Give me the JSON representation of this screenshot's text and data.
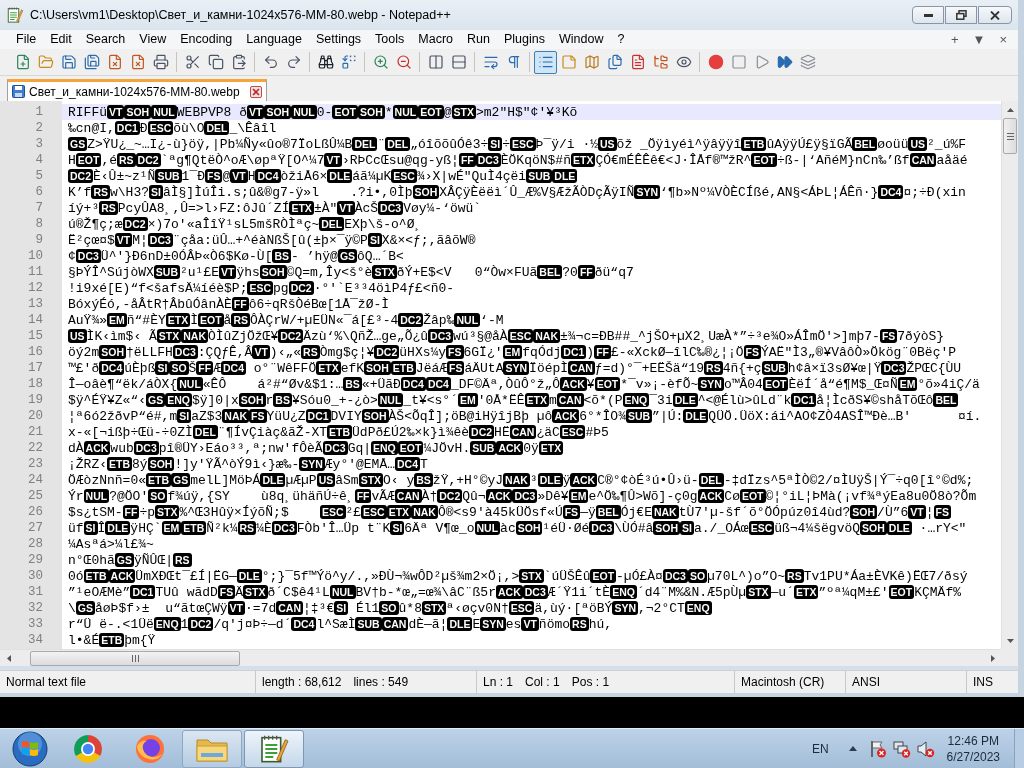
{
  "window": {
    "title": "C:\\Users\\vm1\\Desktop\\Свет_и_камни-1024x576-MM-80.webp - Notepad++"
  },
  "menu": {
    "items": [
      "File",
      "Edit",
      "Search",
      "View",
      "Encoding",
      "Language",
      "Settings",
      "Tools",
      "Macro",
      "Run",
      "Plugins",
      "Window",
      "?"
    ],
    "document_controls": [
      "+",
      "▼",
      "×"
    ]
  },
  "toolbar": [
    {
      "pressed": false
    },
    {
      "pressed": false
    },
    {
      "pressed": false
    },
    {
      "pressed": false
    },
    {
      "pressed": false
    },
    {
      "pressed": false
    },
    {
      "pressed": false
    },
    {
      "pressed": false
    },
    {
      "pressed": false
    },
    {
      "pressed": false
    },
    {
      "pressed": false
    },
    {
      "pressed": false
    },
    {
      "pressed": false
    },
    {
      "pressed": false
    },
    {
      "pressed": false
    },
    {
      "pressed": false
    },
    {
      "pressed": false
    },
    {
      "pressed": false
    },
    {
      "pressed": false
    },
    {
      "pressed": false
    },
    {
      "pressed": true
    },
    {
      "pressed": false
    },
    {
      "pressed": false
    },
    {
      "pressed": false
    },
    {
      "pressed": false
    },
    {
      "pressed": false
    },
    {
      "pressed": false
    },
    {
      "pressed": false
    },
    {
      "pressed": false
    },
    {
      "pressed": false
    },
    {
      "pressed": false
    },
    {
      "pressed": false
    }
  ],
  "tabs": [
    {
      "label": "Свет_и_камни-1024x576-MM-80.webp",
      "selected": true
    }
  ],
  "editor": {
    "lines": [
      {
        "number": "1",
        "current": true,
        "segments": [
          {
            "text": "RIFFü",
            "control": "VT"
          },
          {
            "control": "SOH"
          },
          {
            "control": "NUL"
          },
          {
            "text": "WEBPVP8 ð",
            "control": "VT"
          },
          {
            "control": "SOH"
          },
          {
            "control": "NUL"
          },
          {
            "text": "0-",
            "control": "EOT"
          },
          {
            "control": "SOH"
          },
          {
            "text": "*",
            "control": "NUL"
          },
          {
            "control": "EOT"
          },
          {
            "text": "@",
            "control": "STX"
          },
          {
            "text": ">m2″H$\"¢'¥³Kõ"
          }
        ]
      },
      {
        "number": "2",
        "current": false,
        "segments": [
          {
            "text": "‰cn@I,",
            "control": "DC1"
          },
          {
            "text": "Ð",
            "control": "ESC"
          },
          {
            "text": "õù\\O",
            "control": "DEL"
          },
          {
            "text": "_\\Êâîl"
          }
        ]
      },
      {
        "number": "3",
        "current": false,
        "segments": [
          {
            "control": "GS"
          },
          {
            "text": "Z>ŸU¿_~…I¿-ù}öÿ,|Pb¼Ñy«ûo®7ÏoLßÛ¼B",
            "control": "DEL"
          },
          {
            "text": "¨",
            "control": "DEL"
          },
          {
            "text": "„óîõõûÓê3÷",
            "control": "SI"
          },
          {
            "text": "÷",
            "control": "ESC"
          },
          {
            "text": "Þ¯ÿ/i ·½",
            "control": "US"
          },
          {
            "text": "õž _Öÿìyéì^ÿâÿÿî",
            "control": "ETB"
          },
          {
            "text": "ûAÿÿÚ£ÿ§ïGÃ",
            "control": "BEL"
          },
          {
            "text": "øoüü",
            "control": "US"
          },
          {
            "text": "²_ú%F"
          }
        ]
      },
      {
        "number": "4",
        "current": false,
        "segments": [
          {
            "text": "H",
            "control": "EOT"
          },
          {
            "text": ",é",
            "control": "RS"
          },
          {
            "control": "DC2"
          },
          {
            "text": "`ªg¶QtëÒ^oÆ\\øpªŸ[O^¼7",
            "control": "VT"
          },
          {
            "text": "›RÞCcŒsu@qg-yß¦",
            "control": "FF"
          },
          {
            "control": "DC3"
          },
          {
            "text": "ÈÖKqöN$#ñ",
            "control": "ETX"
          },
          {
            "text": "ÇÓ€mÉÊÊê€<J·ÎÅf®™žR^",
            "control": "EOT"
          },
          {
            "text": "÷ß-|‘AñéM}nCn‰’ßf",
            "control": "CAN"
          },
          {
            "text": "aåäé"
          }
        ]
      },
      {
        "number": "5",
        "current": false,
        "segments": [
          {
            "control": "DC2"
          },
          {
            "text": "È‹Û±~z¹Ñ",
            "control": "SUB"
          },
          {
            "text": "1¯Ð",
            "control": "FS"
          },
          {
            "text": "@",
            "control": "VT"
          },
          {
            "text": "H",
            "control": "DC4"
          },
          {
            "text": "òžiÅ6×",
            "control": "DLE"
          },
          {
            "text": "áã¼µK",
            "control": "ESC"
          },
          {
            "text": "¾›X|wÉ\"QuÌ4çëi",
            "control": "SUB"
          },
          {
            "control": "DLE"
          }
        ]
      },
      {
        "number": "6",
        "current": false,
        "segments": [
          {
            "text": "K’f",
            "control": "RS"
          },
          {
            "text": "w\\H3?",
            "control": "SI"
          },
          {
            "text": "âÌ§]ÌúÎi.s;û&®g7-ÿ»l    .?i•,0Ìþ",
            "control": "SOH"
          },
          {
            "text": "XÂÇÿÈëëì´Û_Æ%V§ÆžÃÒDçÃÿIÑ",
            "control": "SYN"
          },
          {
            "text": "‘¶b»Nº¼VÒÈCÍßé,AN§<ÁÞL¦ÁÊñ·}",
            "control": "DC4"
          },
          {
            "text": "¤;÷Ð(xin"
          }
        ]
      },
      {
        "number": "7",
        "current": false,
        "segments": [
          {
            "text": "íý+³",
            "control": "RS"
          },
          {
            "text": "PcyÛA8¸,Û=>l›FZ:ôJû´ZÍ",
            "control": "ETX"
          },
          {
            "text": "±À\"",
            "control": "VT"
          },
          {
            "text": "ÀcŠ",
            "control": "DC3"
          },
          {
            "text": "Vøy¼-‘öwü`"
          }
        ]
      },
      {
        "number": "8",
        "current": false,
        "segments": [
          {
            "text": "ú®Ž¶ç;æ",
            "control": "DC2"
          },
          {
            "text": "×)7o'«aÎîŸ¹sL5mšRÒÌªç~",
            "control": "DEL"
          },
          {
            "text": "EXþ\\š-o^Ø¸"
          }
        ]
      },
      {
        "number": "9",
        "current": false,
        "segments": [
          {
            "text": "Ë²çœ¤$",
            "control": "VT"
          },
          {
            "text": "M¦",
            "control": "DC3"
          },
          {
            "text": "¨çåa:üÛ…+^éàNßŠ[û(±þ×¯ÿ©P",
            "control": "SI"
          },
          {
            "text": "X&×<ƒ;,ãâõW®"
          }
        ]
      },
      {
        "number": "10",
        "current": false,
        "segments": [
          {
            "text": "¢",
            "control": "DC3"
          },
          {
            "text": "Ü^'}Ð6nD±0ÓÂÞ«Ò6$Kø-Ù[",
            "control": "BS"
          },
          {
            "text": "- ’hÿ@",
            "control": "GS"
          },
          {
            "text": "ôQ…´B<"
          }
        ]
      },
      {
        "number": "11",
        "current": false,
        "segments": [
          {
            "text": "§ÞÝÎ^SújòWX",
            "control": "SUB"
          },
          {
            "text": "²u¹£E",
            "control": "VT"
          },
          {
            "text": "ÿhs",
            "control": "SOH"
          },
          {
            "text": "©Q=m,Îy<š°è",
            "control": "STX"
          },
          {
            "text": "ðÝ+E$<V   0“Òw×FUã",
            "control": "BEL"
          },
          {
            "text": "?0",
            "control": "FF"
          },
          {
            "text": "ðü“q7"
          }
        ]
      },
      {
        "number": "12",
        "current": false,
        "segments": [
          {
            "text": "!i9xé[E)“f<šafsÄ¼íéè$P;",
            "control": "ESC"
          },
          {
            "text": "pg",
            "control": "DC2"
          },
          {
            "text": "·°'`E³³4öìP4ƒ£<ñ0-"
          }
        ]
      },
      {
        "number": "13",
        "current": false,
        "segments": [
          {
            "text": "BóxýÉó,-åÂtR†ÂbûÓânÀÈ",
            "control": "FF"
          },
          {
            "text": "ô6÷qRšÒéBœ[1Å¯žØ-Ì"
          }
        ]
      },
      {
        "number": "14",
        "current": false,
        "segments": [
          {
            "text": "AuŸ¾»",
            "control": "EM"
          },
          {
            "text": "ñ“#ÈY",
            "control": "ETX"
          },
          {
            "text": "Ì",
            "control": "EOT"
          },
          {
            "text": "å",
            "control": "RS"
          },
          {
            "text": "ÔÀÇrW/+µEÜN«¯á[£³-4",
            "control": "DC2"
          },
          {
            "text": "Žâp‰",
            "control": "NUL"
          },
          {
            "text": "‘-M"
          }
        ]
      },
      {
        "number": "15",
        "current": false,
        "segments": [
          {
            "control": "US"
          },
          {
            "text": "ÌK‹ìm$‹ Ã",
            "control": "STX"
          },
          {
            "control": "NAK"
          },
          {
            "text": "ÒÌûZjÖžŒ¥",
            "control": "DC2"
          },
          {
            "text": "Äzù‘%\\QñŽ…ge„Õ¿û",
            "control": "DC3"
          },
          {
            "text": "wú³§@åÀ",
            "control": "ESC"
          },
          {
            "control": "NAK"
          },
          {
            "text": "±¾¬c=ÐB##_^jŠO+µX2¸UæÀ*”÷³e¾O»ÁÎmÖ'>]mþ7-",
            "control": "FS"
          },
          {
            "text": "7ðýòS}"
          }
        ]
      },
      {
        "number": "16",
        "current": false,
        "segments": [
          {
            "text": "öý2m",
            "control": "SOH"
          },
          {
            "text": "†ëLLFH",
            "control": "DC3"
          },
          {
            "text": ":ÇQƒÊ,Â",
            "control": "VT"
          },
          {
            "text": ")‹„«",
            "control": "RS"
          },
          {
            "text": "Òmg$ç¦¥",
            "control": "DC2"
          },
          {
            "text": "üHXs¼y",
            "control": "FS"
          },
          {
            "text": "6GÏ¿'",
            "control": "EM"
          },
          {
            "text": "fqÓdj",
            "control": "DC1"
          },
          {
            "text": ")",
            "control": "FF"
          },
          {
            "text": "£-«XckØ—îlC‰®¿¦¡Ö",
            "control": "FS"
          },
          {
            "text": "ÝAË\"Ì3„®¥VâôÒ»Ökög¨0Bëç'P"
          }
        ]
      },
      {
        "number": "17",
        "current": false,
        "segments": [
          {
            "text": "™£'ð",
            "control": "DC4"
          },
          {
            "text": "úÈþß",
            "control": "SI"
          },
          {
            "control": "SO"
          },
          {
            "text": "Š",
            "control": "FF"
          },
          {
            "text": "Æ",
            "control": "DC4"
          },
          {
            "text": " o°¨WêFFÖ",
            "control": "ETX"
          },
          {
            "text": "efK",
            "control": "SOH"
          },
          {
            "control": "ETB"
          },
          {
            "text": "JëáÆ",
            "control": "FS"
          },
          {
            "text": "áÄUtA",
            "control": "SYN"
          },
          {
            "text": "ÏöépÌ",
            "control": "CAN"
          },
          {
            "text": "ƒ=d)°¯+EËŠä“19",
            "control": "RS"
          },
          {
            "text": "4ñ{+ç",
            "control": "SUB"
          },
          {
            "text": "h¢â×ï3sØ¥œ|Ÿ",
            "control": "DC3"
          },
          {
            "text": "ŽPŒC{ÙU"
          }
        ]
      },
      {
        "number": "18",
        "current": false,
        "segments": [
          {
            "text": "Î—oâè¶“ëk/áÒX{",
            "control": "NUL"
          },
          {
            "text": "«ÊÔ    á²#“Øv&$1:…",
            "control": "BS"
          },
          {
            "text": "«+ÜãÐ",
            "control": "DC4"
          },
          {
            "control": "DC4"
          },
          {
            "text": "_DF©Äª,ÒûÔ°ž„Ô",
            "control": "ACK"
          },
          {
            "text": "¥",
            "control": "EOT"
          },
          {
            "text": "*¯v»¡-èfÕ~",
            "control": "SYN"
          },
          {
            "text": "o™Â04",
            "control": "EOT"
          },
          {
            "text": "ÈëÍ´å“é¶M$_Œ¤Ñ",
            "control": "EM"
          },
          {
            "text": "°õ»4iÇ/ä"
          }
        ]
      },
      {
        "number": "19",
        "current": false,
        "segments": [
          {
            "text": "$ÿ^ÉŸ¥Z«“‹",
            "control": "GS"
          },
          {
            "control": "ENQ"
          },
          {
            "text": "$ÿ]0|x",
            "control": "SOH"
          },
          {
            "text": "r",
            "control": "BS"
          },
          {
            "text": "¥Sóu0_+-¿ò>",
            "control": "NUL"
          },
          {
            "text": "_t¥<s°´",
            "control": "EM"
          },
          {
            "text": "'0Å*ËÊ",
            "control": "ETX"
          },
          {
            "text": "m",
            "control": "CAN"
          },
          {
            "text": "<õ*(P",
            "control": "ENQ"
          },
          {
            "text": "¯3i",
            "control": "DLE"
          },
          {
            "text": "^<@Élù>ûLd¨k",
            "control": "DC1"
          },
          {
            "text": "å¦ÌcðS¥©shåTõŒô",
            "control": "BEL"
          }
        ]
      },
      {
        "number": "20",
        "current": false,
        "segments": [
          {
            "text": "¦ª6ó2žðvP“é#,m",
            "control": "SI"
          },
          {
            "text": "aZ$3",
            "control": "NAK"
          },
          {
            "control": "FS"
          },
          {
            "text": "YüU¿Z",
            "control": "DC1"
          },
          {
            "text": "DVIY",
            "control": "SOH"
          },
          {
            "text": "ÀŠ<ÕqÎ];öB@iHÿîjBþ µô",
            "control": "ACK"
          },
          {
            "text": "6°*ÎO¾",
            "control": "SUB"
          },
          {
            "text": "”|Ú:",
            "control": "DLE"
          },
          {
            "text": "QÜÖ.ÜöX:ái^AO¢ZÒ4ASÎ™Ðè…B'      ¤í."
          }
        ]
      },
      {
        "number": "21",
        "current": false,
        "segments": [
          {
            "text": "x-«[¬ißþ÷Œü-÷0ZÌ",
            "control": "DEL"
          },
          {
            "text": "¨¶ÍvÇiàç&ãŽ-XT",
            "control": "ETB"
          },
          {
            "text": "ÜdPð£Ú2‰×k}ì¾êè",
            "control": "DC2"
          },
          {
            "text": "HË",
            "control": "CAN"
          },
          {
            "text": "¿äC",
            "control": "ESC"
          },
          {
            "text": "#Þ5"
          }
        ]
      },
      {
        "number": "22",
        "current": false,
        "segments": [
          {
            "text": "dÀ",
            "control": "ACK"
          },
          {
            "text": "wub",
            "control": "DC3"
          },
          {
            "text": "pî®ÜY›Eáo³³,ª;nw'fÔèÃ",
            "control": "DC3"
          },
          {
            "text": "Gq|",
            "control": "ENQ"
          },
          {
            "control": "EOT"
          },
          {
            "text": "¼JÖvH.",
            "control": "SUB"
          },
          {
            "control": "ACK"
          },
          {
            "text": "0ÿ",
            "control": "ETX"
          }
        ]
      },
      {
        "number": "23",
        "current": false,
        "segments": [
          {
            "text": "¡ŽRZ‹",
            "control": "ETB"
          },
          {
            "text": "8ý",
            "control": "SOH"
          },
          {
            "text": "!]y'ŸÃ^òÝ9ì‹}æ‰-",
            "control": "SYN"
          },
          {
            "text": "Æy°'@EMÅ…",
            "control": "DC4"
          },
          {
            "text": "T"
          }
        ]
      },
      {
        "number": "24",
        "current": false,
        "segments": [
          {
            "text": "ÖÆòzNnñ=0«",
            "control": "ETB"
          },
          {
            "control": "GS"
          },
          {
            "text": "melL]MöÞÁ",
            "control": "DLE"
          },
          {
            "text": "µÆµP",
            "control": "US"
          },
          {
            "text": "âSm",
            "control": "STX"
          },
          {
            "text": "O‹ y",
            "control": "BS"
          },
          {
            "text": "žŸ,+H°©yJ",
            "control": "NAK"
          },
          {
            "text": "³",
            "control": "DLE"
          },
          {
            "text": "ÿ",
            "control": "ACK"
          },
          {
            "text": "C®°¢òÉ³ú•Û›ü-",
            "control": "DEL"
          },
          {
            "text": "-‡dÏzs^5ªÌÒ©2/¤ÌUÿŠ|Ý¯÷q0[î°©d%;"
          }
        ]
      },
      {
        "number": "25",
        "current": false,
        "segments": [
          {
            "text": "Ýr",
            "control": "NUL"
          },
          {
            "text": "?@ÖO'",
            "control": "SO"
          },
          {
            "text": "f¾úÿ,{SY    ù8q¸ühäñÚ÷ê¸",
            "control": "FF"
          },
          {
            "text": "vÃÆ",
            "control": "CAN"
          },
          {
            "text": "À†",
            "control": "DC2"
          },
          {
            "text": "Qû¬",
            "control": "ACK"
          },
          {
            "control": "DC3"
          },
          {
            "text": "»Dê¥",
            "control": "EM"
          },
          {
            "text": "e^Ö‰¶Û>Wõ]-ç0g",
            "control": "ACK"
          },
          {
            "text": "Cø",
            "control": "EOT"
          },
          {
            "text": "©¦°iL¦ÞMà(¡vf¾ªýEa8u0Ö8ò?Õm"
          }
        ]
      },
      {
        "number": "26",
        "current": false,
        "segments": [
          {
            "text": "$s¿tSM-",
            "control": "FF"
          },
          {
            "text": "÷p",
            "control": "STX"
          },
          {
            "text": "%^Œ3Hûÿ×ÍýõÑ;$    ",
            "control": "ESC"
          },
          {
            "text": "²£",
            "control": "ESC"
          },
          {
            "control": "ETX"
          },
          {
            "control": "NAK"
          },
          {
            "text": "Ô®<s9'à45kÜÖsf«Ú",
            "control": "FS"
          },
          {
            "text": "—ÿ",
            "control": "BEL"
          },
          {
            "text": "Ój€E",
            "control": "NAK"
          },
          {
            "text": "tÙ7'µ-šf´õ°ÖÓpúz0î4ùd?",
            "control": "SOH"
          },
          {
            "text": "/Ù”6",
            "control": "VT"
          },
          {
            "text": "¦",
            "control": "FS"
          }
        ]
      },
      {
        "number": "27",
        "current": false,
        "segments": [
          {
            "text": "üf",
            "control": "SI"
          },
          {
            "text": "Î",
            "control": "DLE"
          },
          {
            "text": "ÿHÇ`",
            "control": "EM"
          },
          {
            "control": "ETB"
          },
          {
            "text": "Ñ²k¼",
            "control": "RS"
          },
          {
            "text": "¼È",
            "control": "DC3"
          },
          {
            "text": "FÒb'Î…Üp t¨K",
            "control": "SI"
          },
          {
            "text": "6Äª V¶œ_o",
            "control": "NUL"
          },
          {
            "text": "àc",
            "control": "SOH"
          },
          {
            "text": "¹éÜ·Øé",
            "control": "DC3"
          },
          {
            "text": "\\ÙÓ#â",
            "control": "SOH"
          },
          {
            "control": "SI"
          },
          {
            "text": "a./_OÁœ",
            "control": "ESC"
          },
          {
            "text": "üß¬4¼šëgvöQ",
            "control": "SOH"
          },
          {
            "control": "DLE"
          },
          {
            "text": " ·…rY<\""
          }
        ]
      },
      {
        "number": "28",
        "current": false,
        "segments": [
          {
            "text": "¼Asªá>¼l£¾~"
          }
        ]
      },
      {
        "number": "29",
        "current": false,
        "segments": [
          {
            "text": "n°Œ0hã",
            "control": "GS"
          },
          {
            "text": "ÿÑÛŒ|",
            "control": "RS"
          }
        ]
      },
      {
        "number": "30",
        "current": false,
        "segments": [
          {
            "text": "0ó",
            "control": "ETB"
          },
          {
            "control": "ACK"
          },
          {
            "text": "ÜmXÐŒt¯£Í|ËG—",
            "control": "DLE"
          },
          {
            "text": "°;}¯5f™Ýö^y/.,»ÐÙ¬¾wÔD²µš¾m2×Ö¡,>",
            "control": "STX"
          },
          {
            "text": "`úÜŠÊû",
            "control": "EOT"
          },
          {
            "text": "-µÓ£À¤",
            "control": "DC3"
          },
          {
            "control": "SO"
          },
          {
            "text": "µ70L^)o”O~",
            "control": "RS"
          },
          {
            "text": "Tv1PU*Áa±ÈVKê)ËŒ7/ðsý"
          }
        ]
      },
      {
        "number": "31",
        "current": false,
        "segments": [
          {
            "text": "”¹eOÆMè”",
            "control": "DC1"
          },
          {
            "text": "TUû wãdD",
            "control": "FS"
          },
          {
            "text": "Ä",
            "control": "STX"
          },
          {
            "text": "ð´C$ê4¹L",
            "control": "NUL"
          },
          {
            "text": "BV†b-*œ„=œ¾\\âC¨ß5r",
            "control": "ACK"
          },
          {
            "control": "DC3"
          },
          {
            "text": "Æ´Ÿ1i´tÈ",
            "control": "ENQ"
          },
          {
            "text": "´d4¨M%&N.Æ5pÙµ",
            "control": "STX"
          },
          {
            "text": "—u´",
            "control": "ETX"
          },
          {
            "text": "”ºª¼qM±£'",
            "control": "EOT"
          },
          {
            "text": "KÇMÄf%"
          }
        ]
      },
      {
        "number": "32",
        "current": false,
        "segments": [
          {
            "text": "\\",
            "control": "GS"
          },
          {
            "text": "åøÞ$f›±  u“ãtœÇWÿ",
            "control": "VT"
          },
          {
            "text": "·=7d",
            "control": "CAN"
          },
          {
            "text": "¦‡³€",
            "control": "SI"
          },
          {
            "text": " Él1",
            "control": "SO"
          },
          {
            "text": "û*8",
            "control": "STX"
          },
          {
            "text": "ª‹øçv0N†",
            "control": "ESC"
          },
          {
            "text": "ä,ùý·[ªöBÝ",
            "control": "SYN"
          },
          {
            "text": ",¬2°CT",
            "control": "ENQ"
          }
        ]
      },
      {
        "number": "33",
        "current": false,
        "segments": [
          {
            "text": "r“Ü ë-.<1Üë",
            "control": "ENQ"
          },
          {
            "text": "1",
            "control": "DC2"
          },
          {
            "text": "/q'j¤Þ÷—d´",
            "control": "DC4"
          },
          {
            "text": "l^SæÌ",
            "control": "SUB"
          },
          {
            "control": "CAN"
          },
          {
            "text": "dÈ—ã¦",
            "control": "DLE"
          },
          {
            "text": "E",
            "control": "SYN"
          },
          {
            "text": "es",
            "control": "VT"
          },
          {
            "text": "ñömo",
            "control": "RS"
          },
          {
            "text": "hú,"
          }
        ]
      },
      {
        "number": "34",
        "current": false,
        "segments": [
          {
            "text": "l•&É",
            "control": "ETB"
          },
          {
            "text": "þm{Ÿ"
          }
        ]
      }
    ]
  },
  "status_bar": [
    {
      "items": [
        "Normal text file"
      ]
    },
    {
      "items": [
        "length : 68,612",
        "lines : 549"
      ]
    },
    {
      "items": [
        "Ln : 1",
        "Col : 1",
        "Pos : 1"
      ]
    },
    {
      "items": [
        "Macintosh (CR)"
      ]
    },
    {
      "items": [
        "ANSI"
      ]
    },
    {
      "items": [
        "INS"
      ]
    }
  ],
  "taskbar": {
    "apps": [
      {
        "running": false,
        "active": false
      },
      {
        "running": false,
        "active": false
      },
      {
        "running": true,
        "active": false
      },
      {
        "running": true,
        "active": true
      }
    ],
    "language": "EN",
    "time": "12:46 PM",
    "date": "6/27/2023"
  }
}
